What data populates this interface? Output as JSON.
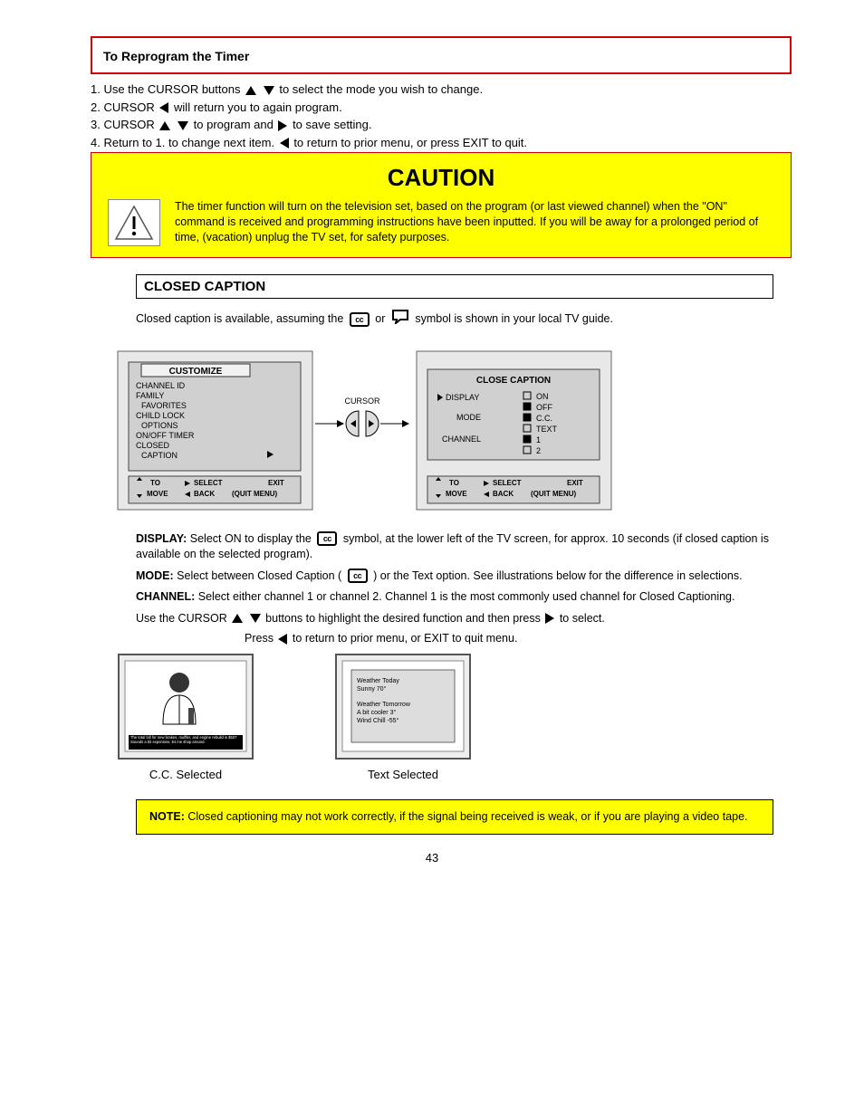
{
  "reprogram": {
    "heading": "To Reprogram the Timer",
    "step1a": "1.  Use the CURSOR buttons ",
    "step1b": " to select the mode you wish to change.",
    "step2a": "2.  CURSOR ",
    "step2b": " will return you to again program.",
    "step3a": "3.  CURSOR ",
    "step3b": " to program and ",
    "step3c": " to save setting.",
    "step4a": "4.  Return to 1. to change next item.  ",
    "step4b": " to return to prior menu, or press EXIT to quit."
  },
  "caution": {
    "title": "CAUTION",
    "text": "The timer function will turn on the television set, based on the program (or last viewed channel) when the \"ON\" command is received and programming instructions have been inputted. If you will be away for a prolonged period of time, (vacation) unplug the TV set, for safety purposes.",
    "icon_name": "warning-triangle-icon"
  },
  "cc": {
    "title": "CLOSED CAPTION",
    "intro_a": "Closed caption is available, assuming the ",
    "intro_b": " or ",
    "intro_c": " symbol is shown in your local TV guide.",
    "diagram": {
      "left": {
        "header": "CUSTOMIZE",
        "items": [
          "CHANNEL ID",
          "FAMILY",
          "FAVORITES",
          "CHILD LOCK",
          "OPTIONS",
          "ON/OFF TIMER",
          "CLOSED",
          "CAPTION"
        ],
        "hint_move_a": "TO",
        "hint_move_b": "MOVE",
        "hint_select": "SELECT",
        "hint_back": "BACK",
        "hint_exit": "EXIT",
        "hint_quit": "(QUIT MENU)"
      },
      "cursor_label": "CURSOR",
      "right": {
        "header": "CLOSE CAPTION",
        "rows": [
          {
            "label": "DISPLAY",
            "opts": [
              "ON",
              "OFF"
            ]
          },
          {
            "label": "MODE",
            "opts": [
              "C.C.",
              "TEXT"
            ]
          },
          {
            "label": "CHANNEL",
            "opts": [
              "1",
              "2"
            ]
          }
        ],
        "hint_move_a": "TO",
        "hint_move_b": "MOVE",
        "hint_select": "SELECT",
        "hint_back": "BACK",
        "hint_exit": "EXIT",
        "hint_quit": "(QUIT MENU)"
      }
    },
    "display_head": "DISPLAY:",
    "display_text_a": "Select ON to display the ",
    "display_text_b": " symbol, at the lower left of the TV screen, for approx. 10 seconds (if closed caption is available on the selected program).",
    "mode_head": "MODE:",
    "mode_text_a": "Select between Closed Caption ( ",
    "mode_text_b": " ) or the Text option. See illustrations below for the difference in selections.",
    "channel_head": "CHANNEL:",
    "channel_text": "Select either channel 1 or channel 2. Channel 1 is the most commonly used channel for Closed Captioning.",
    "use_cursor_a": "Use the CURSOR ",
    "use_cursor_b": " buttons to highlight the desired function and then press ",
    "use_cursor_c": " to select.",
    "return_note_a": "Press ",
    "return_note_b": " to return to prior menu, or EXIT to quit menu.",
    "sample_cc_label": "C.C. Selected",
    "sample_cc_strip": "The total bill for new brakes, muffler, and engine rebuild is $507 Sounds a bit expensive, let me shop around.",
    "sample_text_label": "Text Selected",
    "weather": {
      "l1": "Weather Today",
      "l2": "Sunny 70°",
      "l3": "Weather Tomorrow",
      "l4": "A bit cooler  3°",
      "l5": "Wind Chill  -55°"
    }
  },
  "note": {
    "head": "NOTE:",
    "body": "Closed captioning may not work correctly, if the signal being received is weak, or if you are playing a video tape."
  },
  "page_number": "43"
}
